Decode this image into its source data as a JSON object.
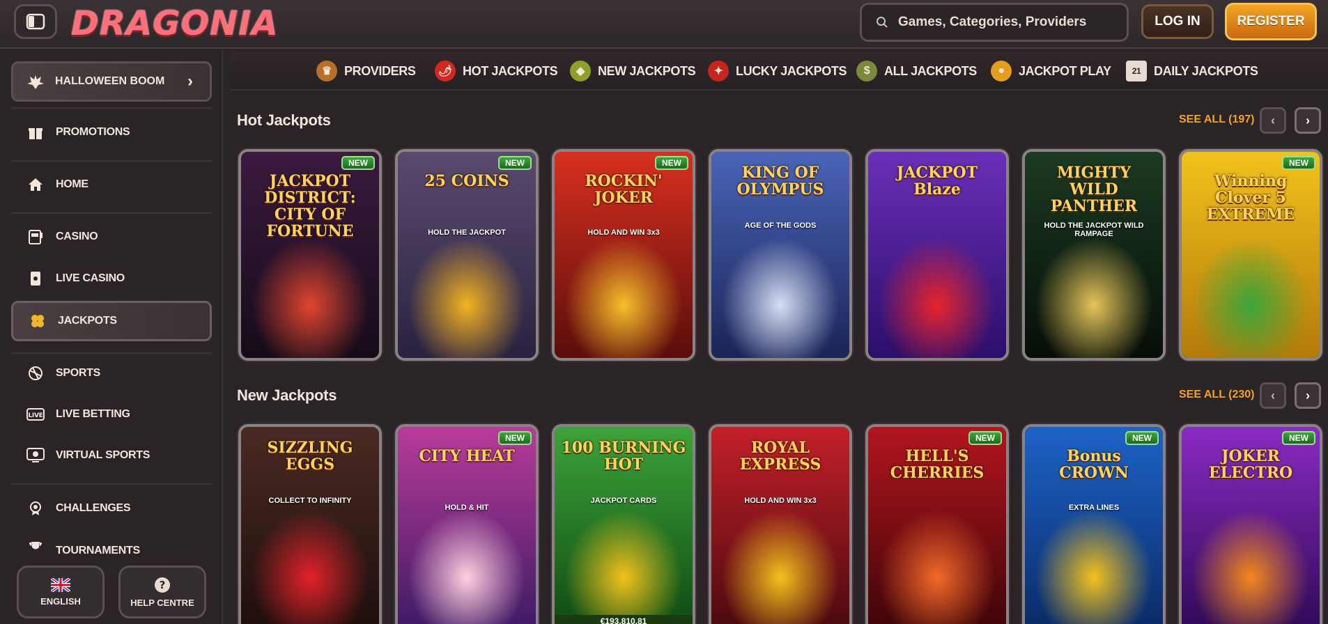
{
  "brand": {
    "logo_text": "DRAGONIA"
  },
  "header": {
    "search_placeholder": "Games, Categories, Providers",
    "login_label": "LOG IN",
    "register_label": "REGISTER"
  },
  "sidebar": {
    "promo_label": "HALLOWEEN BOOM",
    "items": [
      {
        "label": "PROMOTIONS",
        "icon": "gift-icon"
      },
      {
        "label": "HOME",
        "icon": "home-icon"
      },
      {
        "label": "CASINO",
        "icon": "slot-machine-icon"
      },
      {
        "label": "LIVE CASINO",
        "icon": "cards-icon"
      },
      {
        "label": "JACKPOTS",
        "icon": "clover-icon"
      },
      {
        "label": "SPORTS",
        "icon": "ball-icon"
      },
      {
        "label": "LIVE BETTING",
        "icon": "live-icon"
      },
      {
        "label": "VIRTUAL SPORTS",
        "icon": "virtual-ball-icon"
      },
      {
        "label": "CHALLENGES",
        "icon": "medal-icon"
      },
      {
        "label": "TOURNAMENTS",
        "icon": "trophy-icon"
      }
    ],
    "language_label": "ENGLISH",
    "help_label": "HELP CENTRE"
  },
  "categories": [
    {
      "label": "PROVIDERS",
      "icon": "providers-icon"
    },
    {
      "label": "HOT JACKPOTS",
      "icon": "chili-icon"
    },
    {
      "label": "NEW JACKPOTS",
      "icon": "gem-icon"
    },
    {
      "label": "LUCKY JACKPOTS",
      "icon": "lucky-bag-icon"
    },
    {
      "label": "ALL JACKPOTS",
      "icon": "money-bag-icon"
    },
    {
      "label": "JACKPOT PLAY",
      "icon": "coin-bag-icon"
    },
    {
      "label": "DAILY JACKPOTS",
      "icon": "calendar-icon"
    }
  ],
  "calendar_day": "21",
  "new_badge": "NEW",
  "sections": [
    {
      "title": "Hot Jackpots",
      "see_all": "SEE ALL (197)",
      "games": [
        {
          "title": "JACKPOT DISTRICT: CITY OF FORTUNE",
          "new": true,
          "bg": [
            "#3b1a3f",
            "#150b18"
          ],
          "accent": "#e2452f"
        },
        {
          "title": "25 COINS",
          "subtitle": "HOLD THE JACKPOT",
          "new": true,
          "bg": [
            "#5a4a6e",
            "#2a2240"
          ],
          "accent": "#f3b321"
        },
        {
          "title": "ROCKIN' JOKER",
          "subtitle": "HOLD AND WIN 3x3",
          "new": true,
          "bg": [
            "#d8301f",
            "#5a0d0b"
          ],
          "accent": "#f6c02a"
        },
        {
          "title": "KING OF OLYMPUS",
          "subtitle": "AGE OF THE GODS",
          "new": false,
          "bg": [
            "#4a64b8",
            "#1b2457"
          ],
          "accent": "#d8dff4"
        },
        {
          "title": "JACKPOT Blaze",
          "new": false,
          "bg": [
            "#6a2fb8",
            "#2b0e6a"
          ],
          "accent": "#e8242a"
        },
        {
          "title": "MIGHTY WILD PANTHER",
          "subtitle": "HOLD THE JACKPOT WILD RAMPAGE",
          "new": false,
          "bg": [
            "#1c3a22",
            "#060e08"
          ],
          "accent": "#e6c45a"
        },
        {
          "title": "Winning Clover 5 EXTREME",
          "new": true,
          "bg": [
            "#f2c21c",
            "#b47a0a"
          ],
          "accent": "#3aa53a"
        }
      ]
    },
    {
      "title": "New Jackpots",
      "see_all": "SEE ALL (230)",
      "games": [
        {
          "title": "SIZZLING EGGS",
          "subtitle": "COLLECT TO INFINITY",
          "new": false,
          "bg": [
            "#4a2a24",
            "#1e0e0c"
          ],
          "accent": "#e2222a"
        },
        {
          "title": "CITY HEAT",
          "subtitle": "HOLD & HIT",
          "new": true,
          "bg": [
            "#b93b9b",
            "#3d1a64"
          ],
          "accent": "#ffd0e0"
        },
        {
          "title": "100 BURNING HOT",
          "subtitle": "JACKPOT CARDS",
          "new": false,
          "bg": [
            "#3da33a",
            "#0f4a12"
          ],
          "accent": "#f3c21c",
          "jackpot_amount": "€193,810.81"
        },
        {
          "title": "ROYAL EXPRESS",
          "subtitle": "HOLD AND WIN 3x3",
          "new": false,
          "bg": [
            "#c3202a",
            "#4a0a0e"
          ],
          "accent": "#f3c21c"
        },
        {
          "title": "HELL'S CHERRIES",
          "new": true,
          "bg": [
            "#b3151e",
            "#3d0508"
          ],
          "accent": "#f26a2a"
        },
        {
          "title": "Bonus CROWN",
          "subtitle": "EXTRA LINES",
          "new": true,
          "bg": [
            "#1d63c7",
            "#0a2a66"
          ],
          "accent": "#f3c21c"
        },
        {
          "title": "JOKER ELECTRO",
          "new": true,
          "bg": [
            "#8a2ac3",
            "#2f0a55"
          ],
          "accent": "#f3891c"
        }
      ]
    }
  ],
  "colors": {
    "accent": "#f2a424",
    "background": "#2a2426",
    "text": "#f2e6dc"
  }
}
